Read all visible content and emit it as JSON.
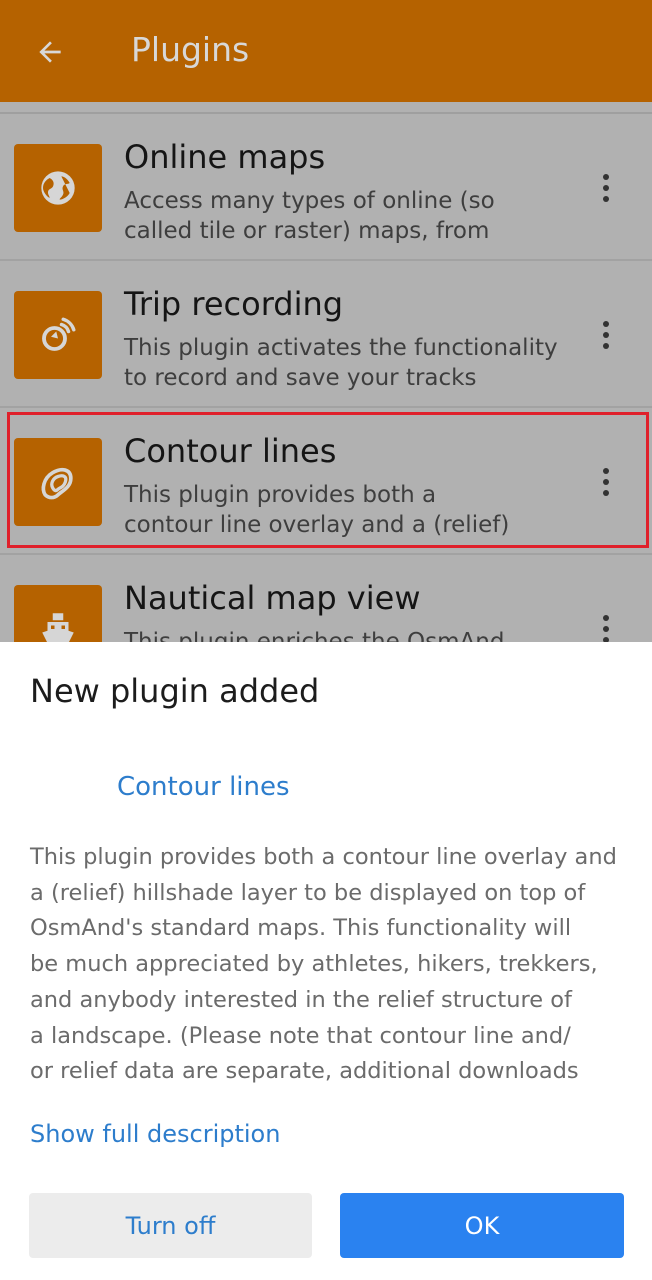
{
  "appbar": {
    "title": "Plugins",
    "back_icon": "arrow-back-icon"
  },
  "plugins": [
    {
      "name": "Online maps",
      "desc_lines": [
        "Access many types of online (so",
        "called tile or raster) maps, from"
      ],
      "icon": "globe-icon"
    },
    {
      "name": "Trip recording",
      "desc_lines": [
        "This plugin activates the functionality",
        "to record and save your tracks"
      ],
      "icon": "trip-recording-icon"
    },
    {
      "name": "Contour lines",
      "desc_lines": [
        "This plugin provides both a",
        "contour line overlay and a (relief)"
      ],
      "icon": "contour-lines-icon"
    },
    {
      "name": "Nautical map view",
      "desc_lines": [
        "This plugin enriches the OsmAnd",
        ""
      ],
      "icon": "ship-icon"
    }
  ],
  "sheet": {
    "title": "New plugin added",
    "plugin_name": "Contour lines",
    "description_lines": [
      "This plugin provides both a contour line overlay and",
      "a (relief) hillshade layer to be displayed on top of",
      "OsmAnd's standard maps. This functionality will",
      "be much appreciated by athletes, hikers, trekkers,",
      "and anybody interested in the relief structure of",
      "a landscape. (Please note that contour line and/",
      "or relief data are separate, additional downloads"
    ],
    "show_full": "Show full description",
    "turn_off": "Turn off",
    "ok": "OK"
  },
  "colors": {
    "accent": "#b56200",
    "link": "#2d7dcc",
    "primary_button": "#2a82f0",
    "highlight": "#e0202b"
  }
}
